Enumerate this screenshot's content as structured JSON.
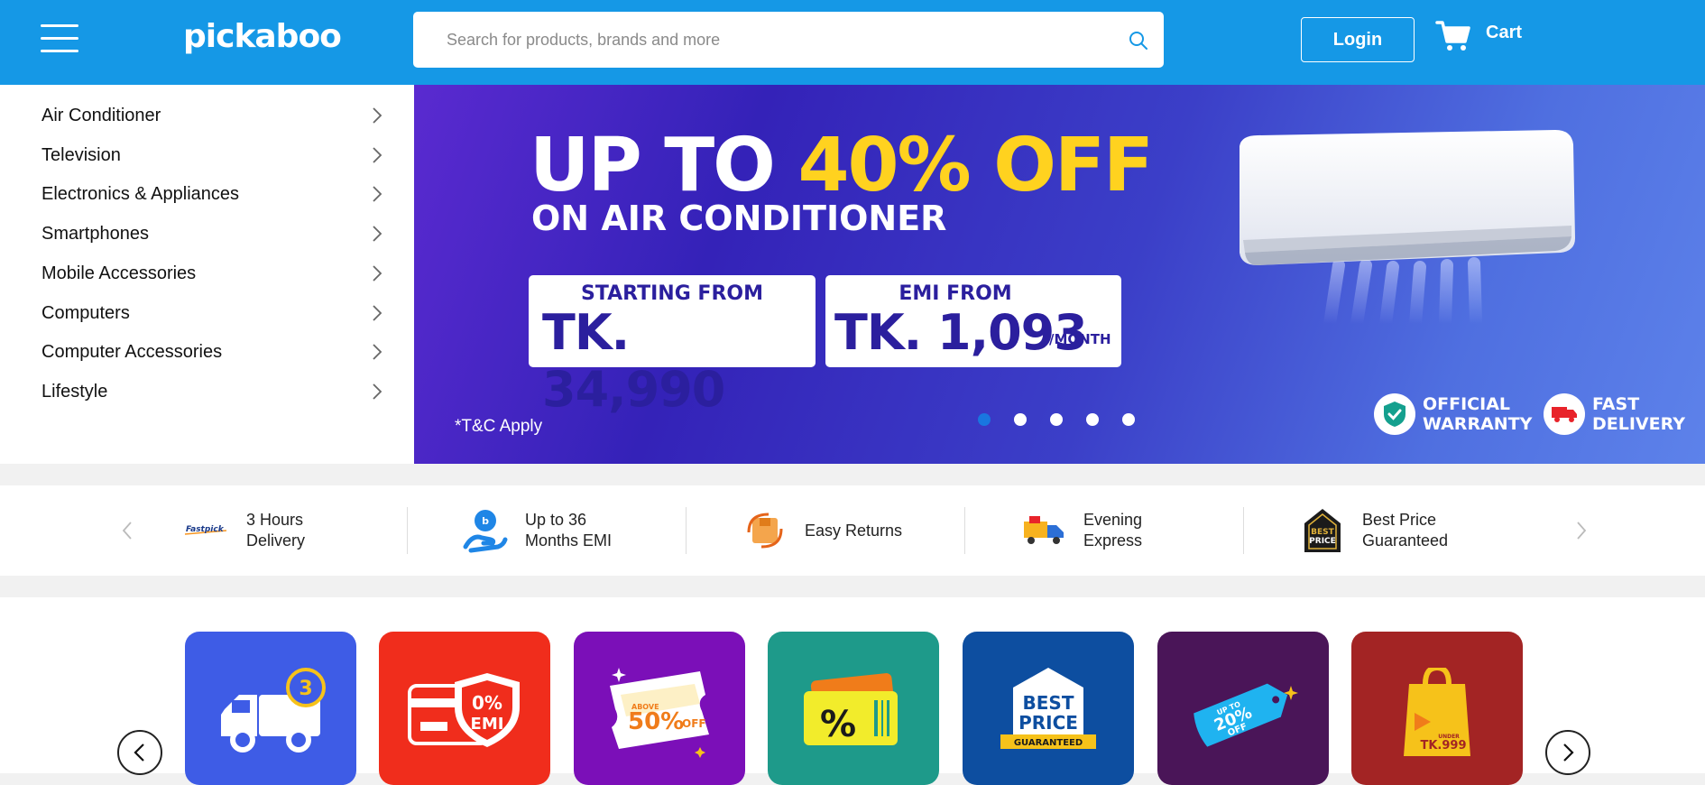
{
  "header": {
    "logo": "pickaboo",
    "search_placeholder": "Search for products, brands and more",
    "login_label": "Login",
    "cart_label": "Cart"
  },
  "sidebar": {
    "categories": [
      "Air Conditioner",
      "Television",
      "Electronics & Appliances",
      "Smartphones",
      "Mobile Accessories",
      "Computers",
      "Computer Accessories",
      "Lifestyle"
    ]
  },
  "banner": {
    "headline_prefix": "UP TO",
    "headline_highlight": "40% OFF",
    "subheadline": "ON AIR CONDITIONER",
    "box1_label": "STARTING FROM",
    "box1_value": "TK. 34,990",
    "box2_label": "EMI FROM",
    "box2_value": "TK. 1,093",
    "box2_unit": "/MONTH",
    "tnc": "*T&C Apply",
    "badge_warranty_line1": "OFFICIAL",
    "badge_warranty_line2": "WARRANTY",
    "badge_delivery_line1": "FAST",
    "badge_delivery_line2": "DELIVERY",
    "slide_count": 5,
    "active_slide": 1,
    "colors": {
      "highlight": "#ffd21f",
      "box_text": "#2b1f9e"
    }
  },
  "features": [
    {
      "icon": "fastpick-icon",
      "line1": "3 Hours",
      "line2": "Delivery",
      "logo_text": "Fastpick"
    },
    {
      "icon": "emi-hand-icon",
      "line1": "Up to 36",
      "line2": "Months EMI"
    },
    {
      "icon": "return-box-icon",
      "line1": "Easy Returns",
      "line2": ""
    },
    {
      "icon": "evening-truck-icon",
      "line1": "Evening",
      "line2": "Express"
    },
    {
      "icon": "best-price-icon",
      "line1": "Best Price",
      "line2": "Guaranteed"
    }
  ],
  "tiles": [
    {
      "icon": "delivery-truck-icon",
      "color": "#3e5ce6",
      "badge": "3"
    },
    {
      "icon": "zero-emi-card-icon",
      "color": "#f02d1c",
      "text1": "0%",
      "text2": "EMI"
    },
    {
      "icon": "ticket-icon",
      "color": "#7b0fb8",
      "text1": "ABOVE",
      "text2": "50%",
      "text3": "OFF"
    },
    {
      "icon": "percent-voucher-icon",
      "color": "#1e9a8a",
      "text1": "%"
    },
    {
      "icon": "best-price-tag-icon",
      "color": "#0d4ea0",
      "text1": "BEST",
      "text2": "PRICE",
      "text3": "GUARANTEED"
    },
    {
      "icon": "twenty-off-tag-icon",
      "color": "#4a1558",
      "text1": "UP TO",
      "text2": "20%",
      "text3": "OFF"
    },
    {
      "icon": "shopping-bag-icon",
      "color": "#a32424",
      "text1": "UNDER",
      "text2": "TK.999"
    }
  ],
  "brand_colors": {
    "header": "#1598e6",
    "text": "#111111"
  }
}
